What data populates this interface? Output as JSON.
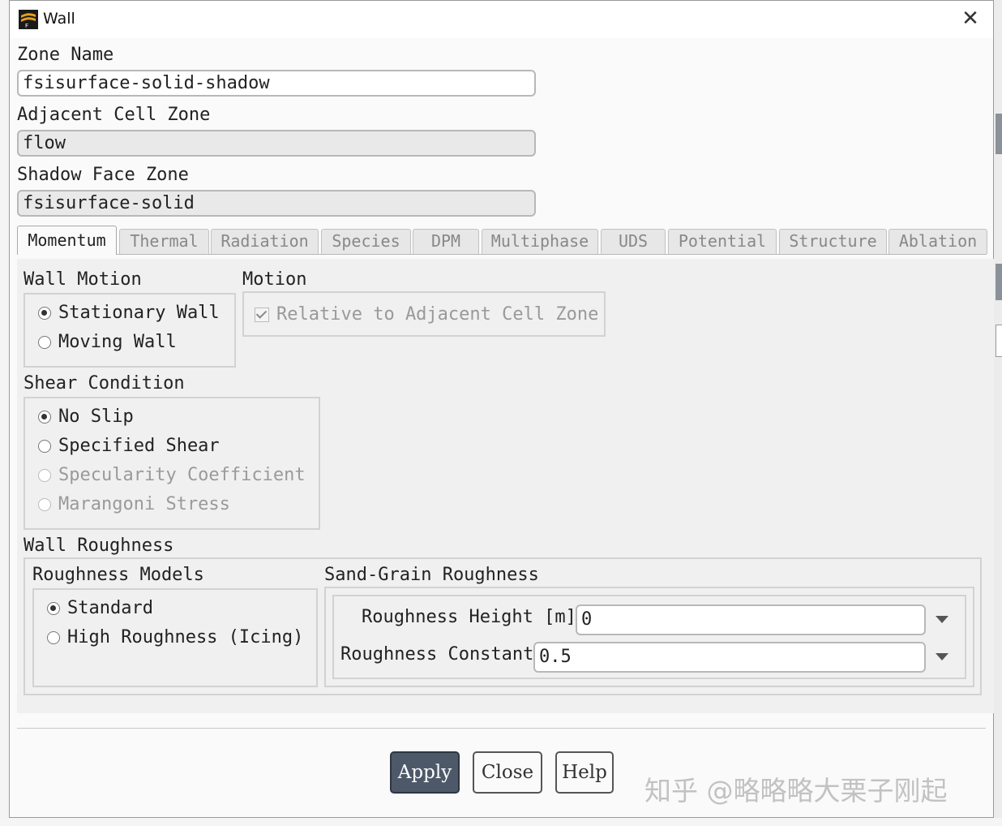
{
  "window": {
    "title": "Wall",
    "close_symbol": "✕"
  },
  "zone_name": {
    "label": "Zone Name",
    "value": "fsisurface-solid-shadow"
  },
  "adjacent_cell_zone": {
    "label": "Adjacent Cell Zone",
    "value": "flow"
  },
  "shadow_face_zone": {
    "label": "Shadow Face Zone",
    "value": "fsisurface-solid"
  },
  "tabs": [
    {
      "label": "Momentum",
      "active": true
    },
    {
      "label": "Thermal"
    },
    {
      "label": "Radiation"
    },
    {
      "label": "Species"
    },
    {
      "label": "DPM"
    },
    {
      "label": "Multiphase"
    },
    {
      "label": "UDS"
    },
    {
      "label": "Potential"
    },
    {
      "label": "Structure"
    },
    {
      "label": "Ablation"
    }
  ],
  "wall_motion": {
    "title": "Wall Motion",
    "options": [
      {
        "label": "Stationary Wall",
        "selected": true
      },
      {
        "label": "Moving Wall",
        "selected": false
      }
    ]
  },
  "motion": {
    "title": "Motion",
    "relative_label": "Relative to Adjacent Cell Zone",
    "relative_checked": true,
    "relative_disabled": true
  },
  "shear_condition": {
    "title": "Shear Condition",
    "options": [
      {
        "label": "No Slip",
        "selected": true,
        "disabled": false
      },
      {
        "label": "Specified Shear",
        "selected": false,
        "disabled": false
      },
      {
        "label": "Specularity Coefficient",
        "selected": false,
        "disabled": true
      },
      {
        "label": "Marangoni Stress",
        "selected": false,
        "disabled": true
      }
    ]
  },
  "wall_roughness": {
    "title": "Wall Roughness",
    "models_title": "Roughness Models",
    "models": [
      {
        "label": "Standard",
        "selected": true
      },
      {
        "label": "High Roughness (Icing)",
        "selected": false
      }
    ],
    "sand_grain_title": "Sand-Grain Roughness",
    "height_label": "Roughness Height [m]",
    "height_value": "0",
    "constant_label": "Roughness Constant",
    "constant_value": "0.5"
  },
  "buttons": {
    "apply": "Apply",
    "close": "Close",
    "help": "Help"
  },
  "watermark": "知乎 @略略略大栗子刚起",
  "colors": {
    "primary_button": "#4d5968",
    "window_bg": "#fafafa",
    "panel_bg": "#f0f0f0"
  }
}
